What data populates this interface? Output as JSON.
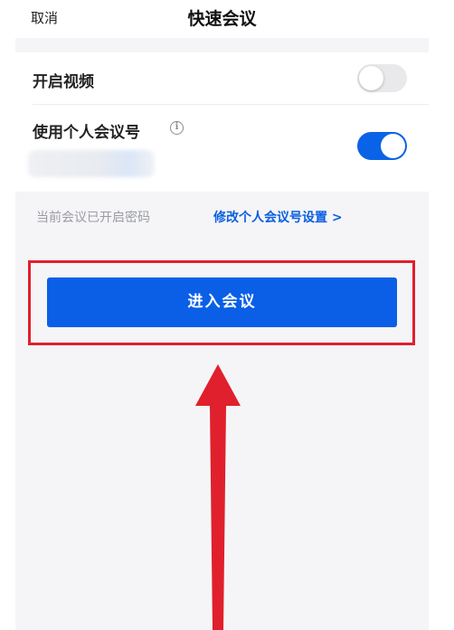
{
  "header": {
    "cancel_label": "取消",
    "title": "快速会议"
  },
  "settings": {
    "video": {
      "label": "开启视频",
      "enabled": false
    },
    "personal_meeting_id": {
      "label": "使用个人会议号",
      "info_icon": "info-icon",
      "enabled": true
    }
  },
  "password_note": {
    "text": "当前会议已开启密码",
    "link_label": "修改个人会议号设置 >"
  },
  "enter_button": {
    "label": "进入会议"
  },
  "annotation": {
    "highlight_color": "#e0202c",
    "arrow_color": "#e0202c"
  },
  "colors": {
    "accent": "#0a5fe6",
    "toggle_off": "#e9e9ec",
    "background": "#f5f5f7"
  }
}
